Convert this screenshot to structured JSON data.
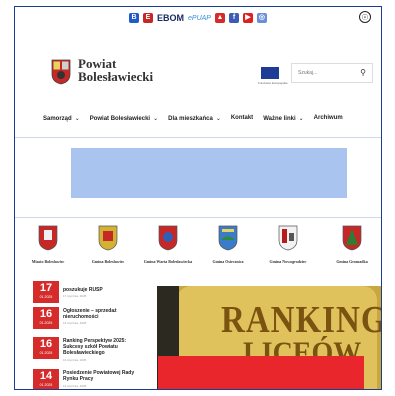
{
  "toplinks": {
    "ebom": "EBOM",
    "epuap": "ePUAP"
  },
  "header": {
    "title_line1": "Powiat",
    "title_line2": "Bolesławiecki",
    "search_placeholder": "Szukaj...",
    "eu_caption": "Fundusze Europejskie"
  },
  "nav": {
    "items": [
      {
        "label": "Samorząd",
        "dropdown": true
      },
      {
        "label": "Powiat Bolesławiecki",
        "dropdown": true
      },
      {
        "label": "Dla mieszkańca",
        "dropdown": true
      },
      {
        "label": "Kontakt",
        "dropdown": false
      },
      {
        "label": "Ważne linki",
        "dropdown": true
      },
      {
        "label": "Archiwum",
        "dropdown": false
      }
    ]
  },
  "gminy": [
    {
      "label": "Miasto Bolesławiec",
      "color": "#c62828"
    },
    {
      "label": "Gmina Bolesławiec",
      "color": "#d1b233"
    },
    {
      "label": "Gmina Warta Bolesławiecka",
      "color": "#c62828"
    },
    {
      "label": "Gmina Osiecznica",
      "color": "#3b7bc8"
    },
    {
      "label": "Gmina Nowogrodziec",
      "color": "#b71c1c"
    },
    {
      "label": "Gmina Gromadka",
      "color": "#c62828"
    }
  ],
  "news": [
    {
      "day": "17",
      "month": "01.2025",
      "title": "poszukuje RUSP",
      "date": "17 stycznia, 2025"
    },
    {
      "day": "16",
      "month": "01.2025",
      "title": "Ogłoszenie – sprzedaż nieruchomości",
      "date": "16 stycznia, 2025"
    },
    {
      "day": "16",
      "month": "01.2025",
      "title": "Ranking Perspektyw 2025: Sukcesy szkół Powiatu Bolesławieckiego",
      "date": "16 stycznia, 2025"
    },
    {
      "day": "14",
      "month": "01.2025",
      "title": "Posiedzenie Powiatowej Rady Rynku Pracy",
      "date": "14 stycznia, 2025"
    }
  ],
  "promo": {
    "line1": "RANKING",
    "line2": "LICEÓW"
  },
  "colors": {
    "accent_red": "#d62b2b",
    "banner_blue": "#a9c5ef",
    "frame_blue": "#1a3d8f"
  }
}
